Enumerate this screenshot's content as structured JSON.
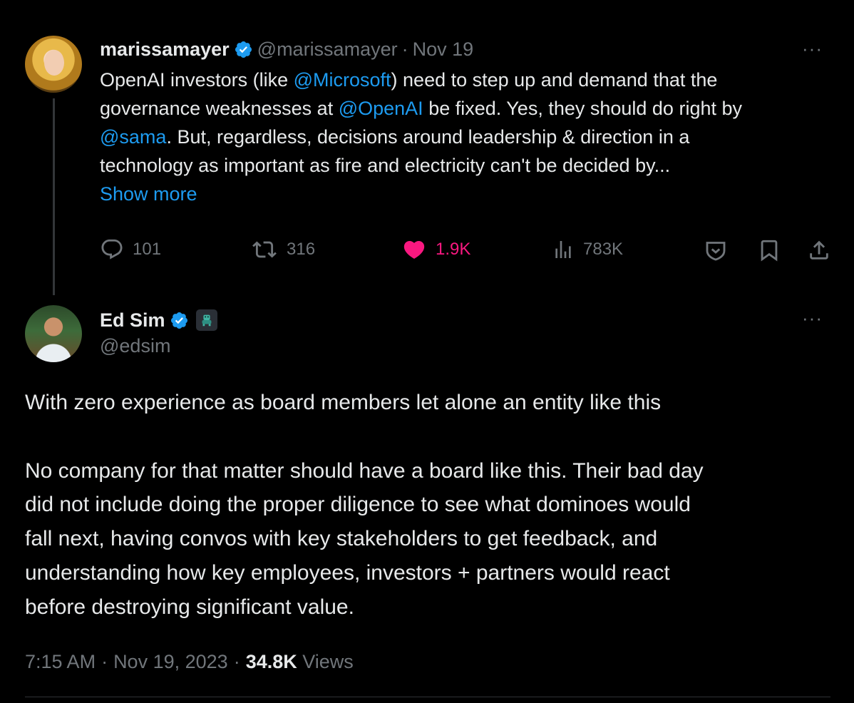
{
  "parent_tweet": {
    "display_name": "marissamayer",
    "handle": "@marissamayer",
    "date_sep": "·",
    "date": "Nov 19",
    "text": {
      "l1_a": "OpenAI investors (like ",
      "l1_mention": "@Microsoft",
      "l1_b": ") need to step up and demand that the",
      "l2_a": "governance weaknesses at ",
      "l2_mention": "@OpenAI",
      "l2_b": " be fixed.  Yes, they should do right by",
      "l3_mention": "@sama",
      "l3_b": ". But, regardless, decisions around leadership & direction in a",
      "l4": "technology as important as fire and electricity can't be decided by..."
    },
    "show_more": "Show more",
    "actions": {
      "replies": "101",
      "reposts": "316",
      "likes": "1.9K",
      "views": "783K"
    },
    "more_menu": "···",
    "icons": [
      "verified-badge-icon",
      "reply-icon",
      "repost-icon",
      "heart-icon",
      "views-icon",
      "grok-shield-icon",
      "bookmark-icon",
      "share-icon",
      "more-icon"
    ]
  },
  "main_tweet": {
    "display_name": "Ed Sim",
    "handle": "@edsim",
    "more_menu": "···",
    "paragraphs": {
      "p1": "With zero experience as board members let alone an entity like this",
      "p2_l1": "No company for that matter should have a board like this. Their bad day",
      "p2_l2": "did not include doing the proper diligence to see what dominoes would",
      "p2_l3": "fall next, having convos with key stakeholders to get feedback, and",
      "p2_l4": "understanding how key employees, investors + partners would react",
      "p2_l5": "before destroying significant value."
    },
    "meta": {
      "time": "7:15 AM",
      "sep1": "·",
      "date": "Nov 19, 2023",
      "sep2": "·",
      "views_count": "34.8K",
      "views_label": "Views"
    }
  },
  "colors": {
    "background": "#000000",
    "text": "#e7e9ea",
    "secondary": "#71767b",
    "link": "#1d9bf0",
    "like": "#f91880",
    "verified": "#1d9bf0"
  }
}
